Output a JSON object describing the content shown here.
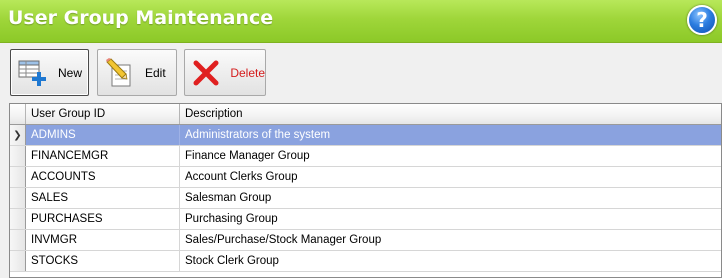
{
  "window": {
    "title": "User Group Maintenance",
    "help_label": "?"
  },
  "toolbar": {
    "new_label": "New",
    "edit_label": "Edit",
    "delete_label": "Delete"
  },
  "grid": {
    "columns": [
      "User Group ID",
      "Description"
    ],
    "selected_row": 0,
    "rows": [
      {
        "id": "ADMINS",
        "description": "Administrators of the system"
      },
      {
        "id": "FINANCEMGR",
        "description": "Finance Manager Group"
      },
      {
        "id": "ACCOUNTS",
        "description": "Account Clerks Group"
      },
      {
        "id": "SALES",
        "description": "Salesman Group"
      },
      {
        "id": "PURCHASES",
        "description": "Purchasing Group"
      },
      {
        "id": "INVMGR",
        "description": "Sales/Purchase/Stock Manager Group"
      },
      {
        "id": "STOCKS",
        "description": "Stock Clerk Group"
      }
    ]
  },
  "colors": {
    "title_bar": "#9fd63a",
    "selection": "#8aa2df",
    "delete_text": "#d41c1c"
  },
  "icons": {
    "new": "table-add-icon",
    "edit": "pencil-document-icon",
    "delete": "red-x-icon",
    "help": "help-icon",
    "row_pointer": "row-pointer-icon"
  }
}
